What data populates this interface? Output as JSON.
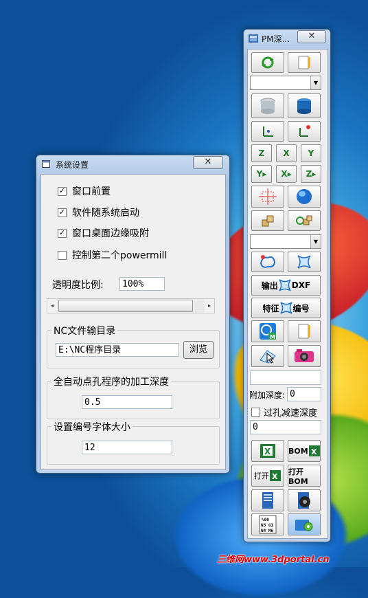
{
  "settings_window": {
    "title": "系统设置",
    "close": "✕",
    "options": [
      {
        "label": "窗口前置",
        "checked": true
      },
      {
        "label": "软件随系统启动",
        "checked": true
      },
      {
        "label": "窗口桌面边缘吸附",
        "checked": true
      },
      {
        "label": "控制第二个powermill",
        "checked": false
      }
    ],
    "opacity_label": "透明度比例:",
    "opacity_value": "100%",
    "opacity_slider_left": "◂",
    "opacity_slider_right": "▸",
    "nc_group": {
      "title": "NC文件输目录",
      "path": "E:\\NC程序目录",
      "browse": "浏览"
    },
    "depth_group": {
      "title": "全自动点孔程序的加工深度",
      "value": "0.5"
    },
    "font_group": {
      "title": "设置编号字体大小",
      "value": "12"
    }
  },
  "pm_toolbar": {
    "title": "PM深...",
    "close": "✕",
    "export_dxf": {
      "prefix": "输出",
      "suffix": "DXF"
    },
    "feature_number": {
      "prefix": "特征",
      "suffix": "编号"
    },
    "bom": "BOM",
    "open_label": "打开",
    "open_bom": "打开BOM",
    "extra_depth_label": "附加深度:",
    "extra_depth_value": "0",
    "via_slow_label": "过孔减速深度",
    "via_slow_checked": false,
    "bottom_value": "0",
    "nc_code_lines": [
      "%00",
      "N3 G1",
      "N4 M6"
    ]
  },
  "watermark": "三维网www.3dportal.cn"
}
